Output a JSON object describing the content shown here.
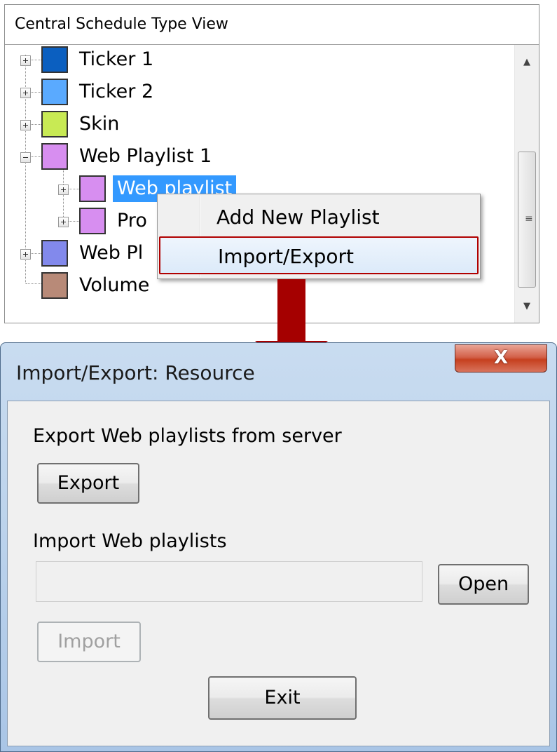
{
  "tree": {
    "header": "Central Schedule Type View",
    "nodes": [
      {
        "label": "Ticker 1",
        "color": "#0b5fc0"
      },
      {
        "label": "Ticker 2",
        "color": "#5aaaff"
      },
      {
        "label": "Skin",
        "color": "#c8ea54"
      },
      {
        "label": "Web Playlist 1",
        "color": "#d78ef0"
      },
      {
        "label": "Web playlist",
        "color": "#d78ef0"
      },
      {
        "label": "Pro",
        "color": "#d78ef0"
      },
      {
        "label": "Web Pl",
        "color": "#8289ec"
      },
      {
        "label": "Volume",
        "color": "#b88a78"
      }
    ]
  },
  "context_menu": {
    "items": [
      "Add New Playlist",
      "Import/Export"
    ],
    "highlighted": "Import/Export"
  },
  "dialog": {
    "title": "Import/Export: Resource",
    "close_glyph": "X",
    "export_label": "Export Web playlists from server",
    "export_button": "Export",
    "import_label": "Import Web playlists",
    "file_path_value": "",
    "open_button": "Open",
    "import_button": "Import",
    "exit_button": "Exit"
  },
  "colors": {
    "selection": "#3399ff",
    "highlight_border": "#b00000",
    "arrow": "#a50000"
  }
}
